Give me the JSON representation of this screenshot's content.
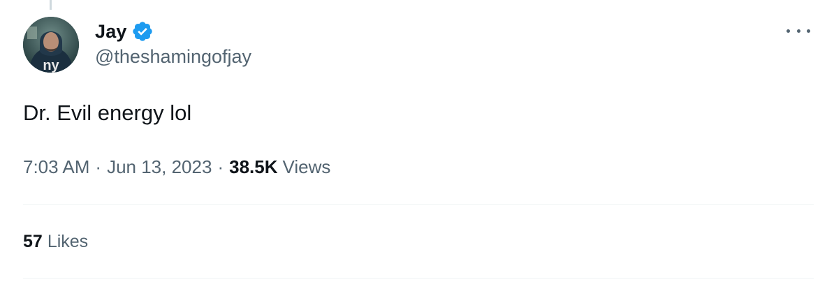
{
  "author": {
    "name": "Jay",
    "handle": "@theshamingofjay",
    "verified": true,
    "avatar_text": "ny"
  },
  "tweet": {
    "text": "Dr. Evil energy lol",
    "time": "7:03 AM",
    "separator": "·",
    "date": "Jun 13, 2023",
    "views_count": "38.5K",
    "views_label": "Views"
  },
  "stats": {
    "likes_count": "57",
    "likes_label": "Likes"
  },
  "colors": {
    "text_primary": "#0f1419",
    "text_secondary": "#536471",
    "verified_blue": "#1d9bf0",
    "divider": "#eff3f4"
  },
  "icons": {
    "verified": "verified-badge-icon",
    "more": "more-horizontal-icon"
  }
}
